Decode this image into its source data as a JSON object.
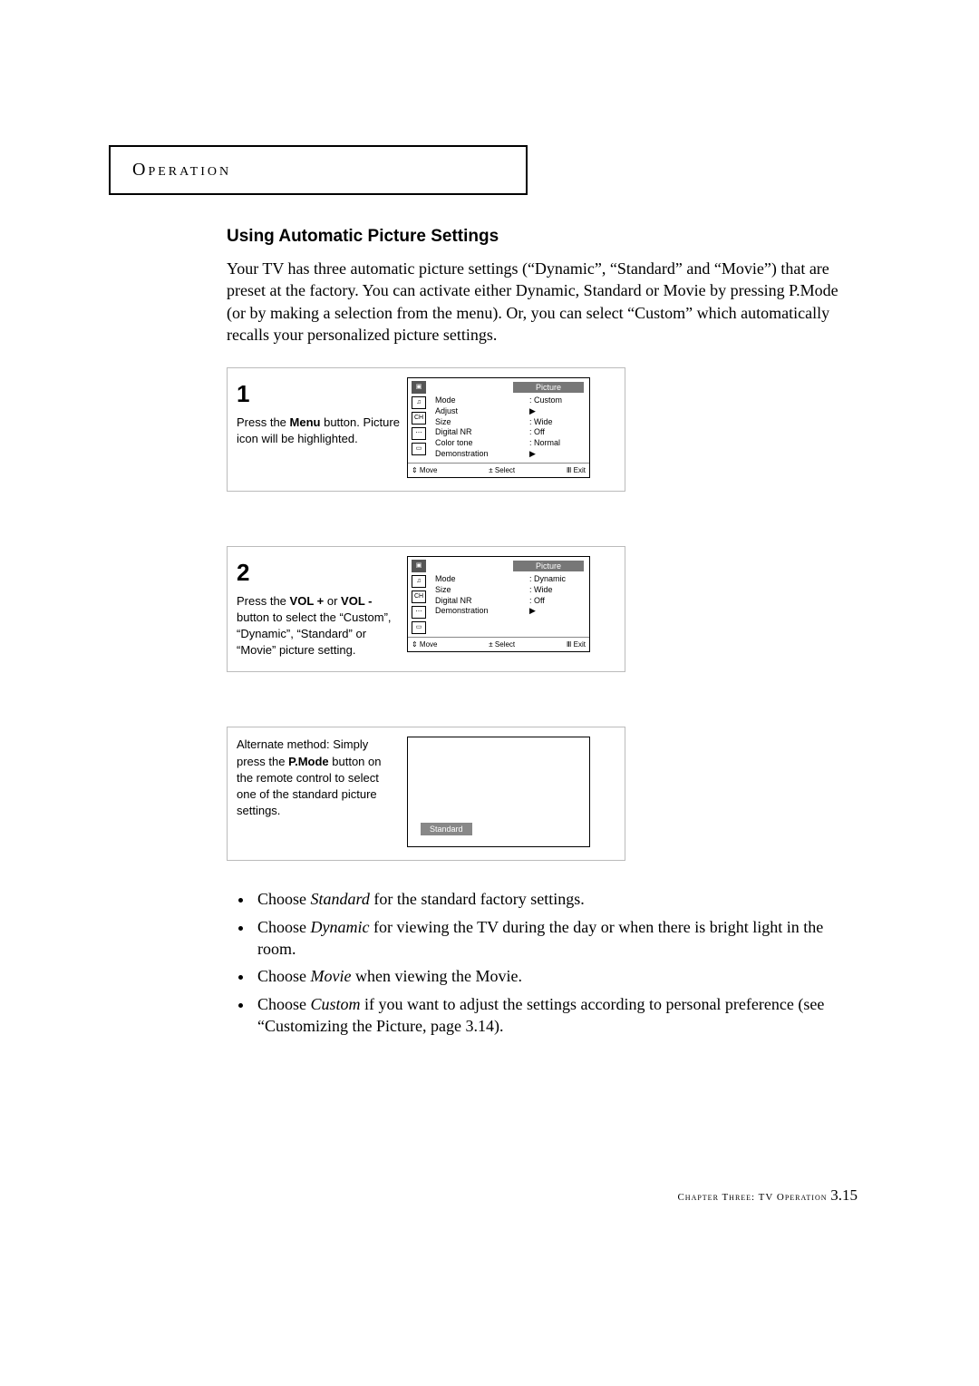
{
  "header": "Operation",
  "section_title": "Using Automatic Picture Settings",
  "intro": "Your TV has three automatic picture settings (“Dynamic”, “Standard” and “Movie”) that are preset at the factory.  You can activate either Dynamic, Standard or Movie by pressing P.Mode (or by making a selection from the menu). Or, you can select “Custom” which automatically recalls your personalized picture settings.",
  "step1": {
    "num": "1",
    "text_a": "Press the ",
    "text_b": "Menu",
    "text_c": " button. Picture icon will be high­lighted."
  },
  "osd1": {
    "title": "Picture",
    "rows": [
      {
        "lab": "Mode",
        "val": ": Custom"
      },
      {
        "lab": "Adjust",
        "val": "▶"
      },
      {
        "lab": "Size",
        "val": ": Wide"
      },
      {
        "lab": "Digital NR",
        "val": ": Off"
      },
      {
        "lab": "Color tone",
        "val": ": Normal"
      },
      {
        "lab": "Demonstration",
        "val": "▶"
      }
    ],
    "footer": {
      "move": "⇕ Move",
      "select": "± Select",
      "exit": "Ⅲ Exit"
    }
  },
  "step2": {
    "num": "2",
    "text_a": "Press the ",
    "text_b": "VOL +",
    "text_c": " or ",
    "text_d": "VOL -",
    "text_e": " button to select the “Custom”, “Dynamic”, “Standard” or “Movie” picture setting."
  },
  "osd2": {
    "title": "Picture",
    "rows": [
      {
        "lab": "Mode",
        "val": ": Dynamic"
      },
      {
        "lab": "Size",
        "val": ": Wide"
      },
      {
        "lab": "Digital NR",
        "val": ": Off"
      },
      {
        "lab": "Demonstration",
        "val": "▶"
      }
    ],
    "footer": {
      "move": "⇕ Move",
      "select": "± Select",
      "exit": "Ⅲ Exit"
    }
  },
  "step3": {
    "text_a": "Alternate method: Simply press the ",
    "text_b": "P.Mode",
    "text_c": " button on the remote control to select one of the standard picture settings."
  },
  "pmode_label": "Standard",
  "bullets": [
    {
      "pre": "Choose ",
      "em": "Standard",
      "post": " for the standard factory settings."
    },
    {
      "pre": "Choose ",
      "em": "Dynamic",
      "post": " for viewing the TV during the day or when there is bright light in the room."
    },
    {
      "pre": "Choose ",
      "em": "Movie",
      "post": " when viewing the Movie."
    },
    {
      "pre": "Choose ",
      "em": "Custom",
      "post": " if you want to adjust the settings according to personal pref­erence (see “Customizing the Picture, page 3.14)."
    }
  ],
  "footer": {
    "chapter": "Chapter Three:  TV Operation  ",
    "page": "3.15"
  }
}
